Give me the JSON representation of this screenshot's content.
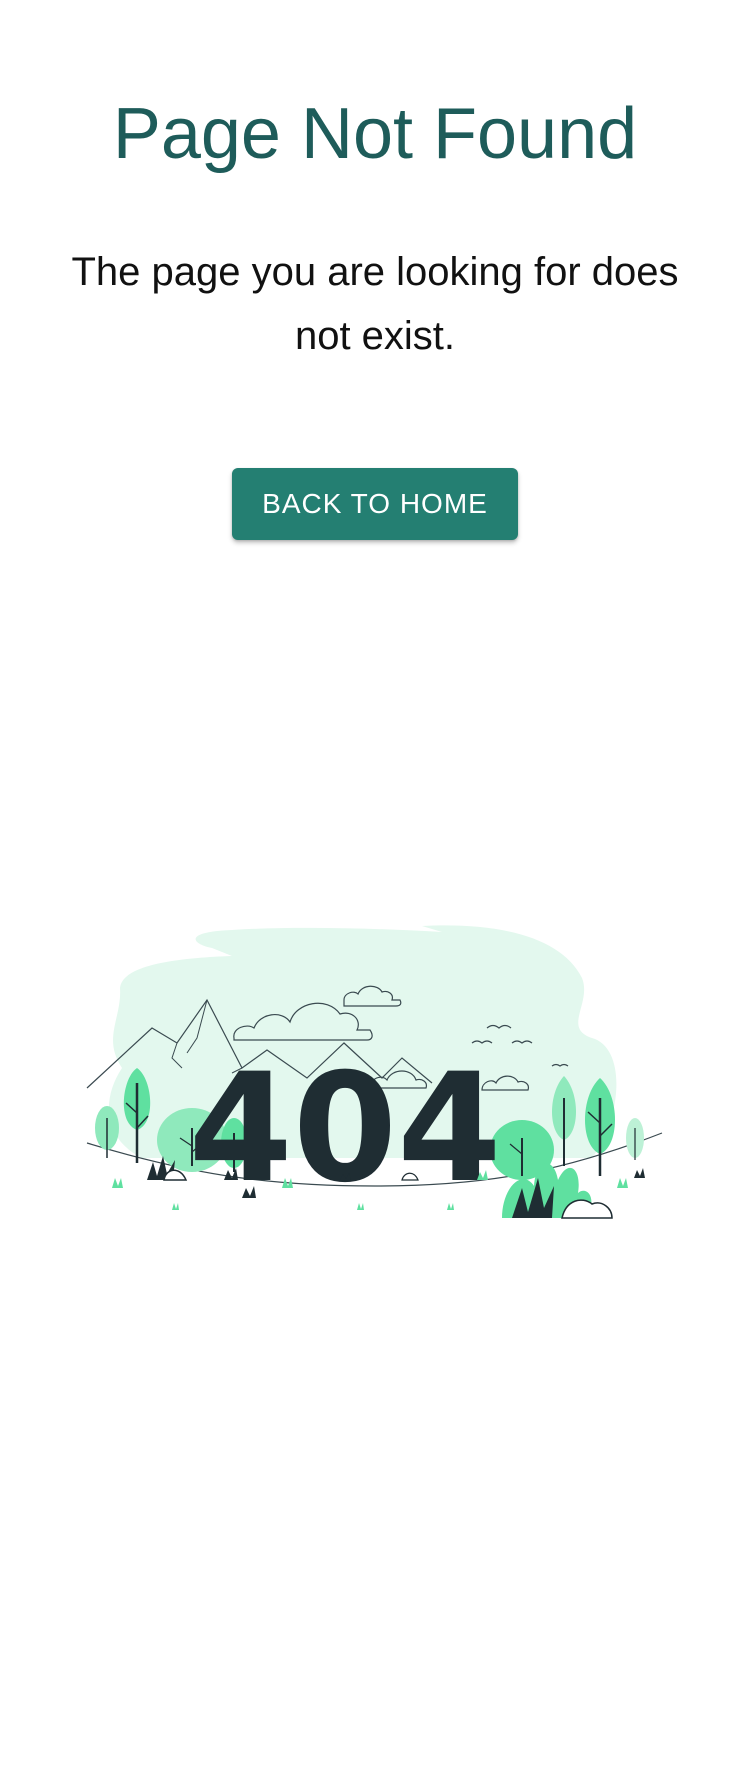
{
  "page": {
    "title": "Page Not Found",
    "message": "The page you are looking for does not exist.",
    "back_button_label": "BACK TO HOME"
  },
  "illustration": {
    "code_text": "404",
    "icon": "404-landscape-illustration"
  },
  "colors": {
    "title": "#1e5c5a",
    "button_bg": "#247f72",
    "button_text": "#ffffff",
    "accent_green": "#5fe0a0",
    "light_green": "#e3f8ee",
    "dark": "#1f2d33"
  }
}
